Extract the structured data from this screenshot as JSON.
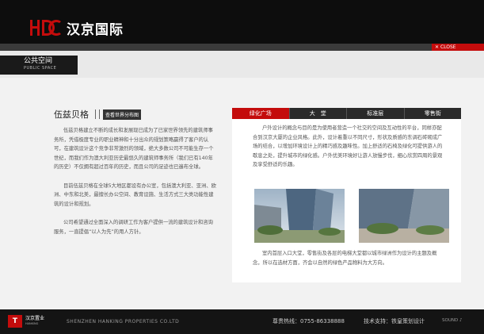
{
  "header": {
    "logo_text": "汉京国际",
    "close_label": "CLOSE"
  },
  "section": {
    "title_cn": "公共空间",
    "title_en": "PUBLIC SPACE"
  },
  "left": {
    "title": "伍兹贝格",
    "map_button": "查看世界分布图",
    "paragraphs": [
      "伍兹贝格建立不断的成长和发展现已成为了已家世界领先的建筑师事务所，凭借极度专业的职业精神和十分出众的规划策略赢得了客户的认可，在建筑设计这个竞争非常激烈的领域，绝大多数公司不可能生存一个世纪，而我们作为澳大利亚历史最悠久的建筑师事务所（我们已有140年的历史）不仅拥有超过百年的历史，而且公司的足迹也已遍布全球。",
      "目前伍兹贝格在全球5大地区都设有办公室，包括澳大利亚、亚洲、欧洲、中东和北美，最擅长办公空间、教育设施、生活方式三大类功能性建筑的设计和规划。",
      "公司希望通过全面深入的调研工作为客户提供一流的建筑设计和咨询服务，一直提倡“以人为先”的用人方针。"
    ]
  },
  "tabs": [
    "绿化广场",
    "大　堂",
    "标准层",
    "零售街"
  ],
  "right": {
    "paragraph1": "户外设计的概念与目的是为使用者营造一个社交的空间及互动性的平台，同样亦配合到汉京大厦的企业风格。此外，设计着重以不同尺寸，形状及质感的东调石砖砌成广场的结合，以增加环境设计上的精巧感及趣味性。加上舒适的石椅及绿化可提供游人的歇息之处，提升城市的绿化感。户外优美环境好让游人放慢步伐，细心欣赏四周的景观及享受舒适的乐趣。",
    "paragraph2": "室内首层入口大堂，零售街及各层的电梯大堂都以城市绿洲作为设计的主题及概念，所以在选材方面，齐会以自然的绿色产品物料为大方向。"
  },
  "footer": {
    "logo_cn": "汉京置业",
    "logo_en": "HANKING",
    "company": "SHENZHEN HANKING PROPERTIES CO.LTD",
    "hotline": "尊贵热线：0755-86338888",
    "support": "技术支持：铁皇策划设计",
    "sound": "SOUND"
  },
  "colors": {
    "accent": "#c40c0c",
    "dark": "#0d0d0d"
  }
}
